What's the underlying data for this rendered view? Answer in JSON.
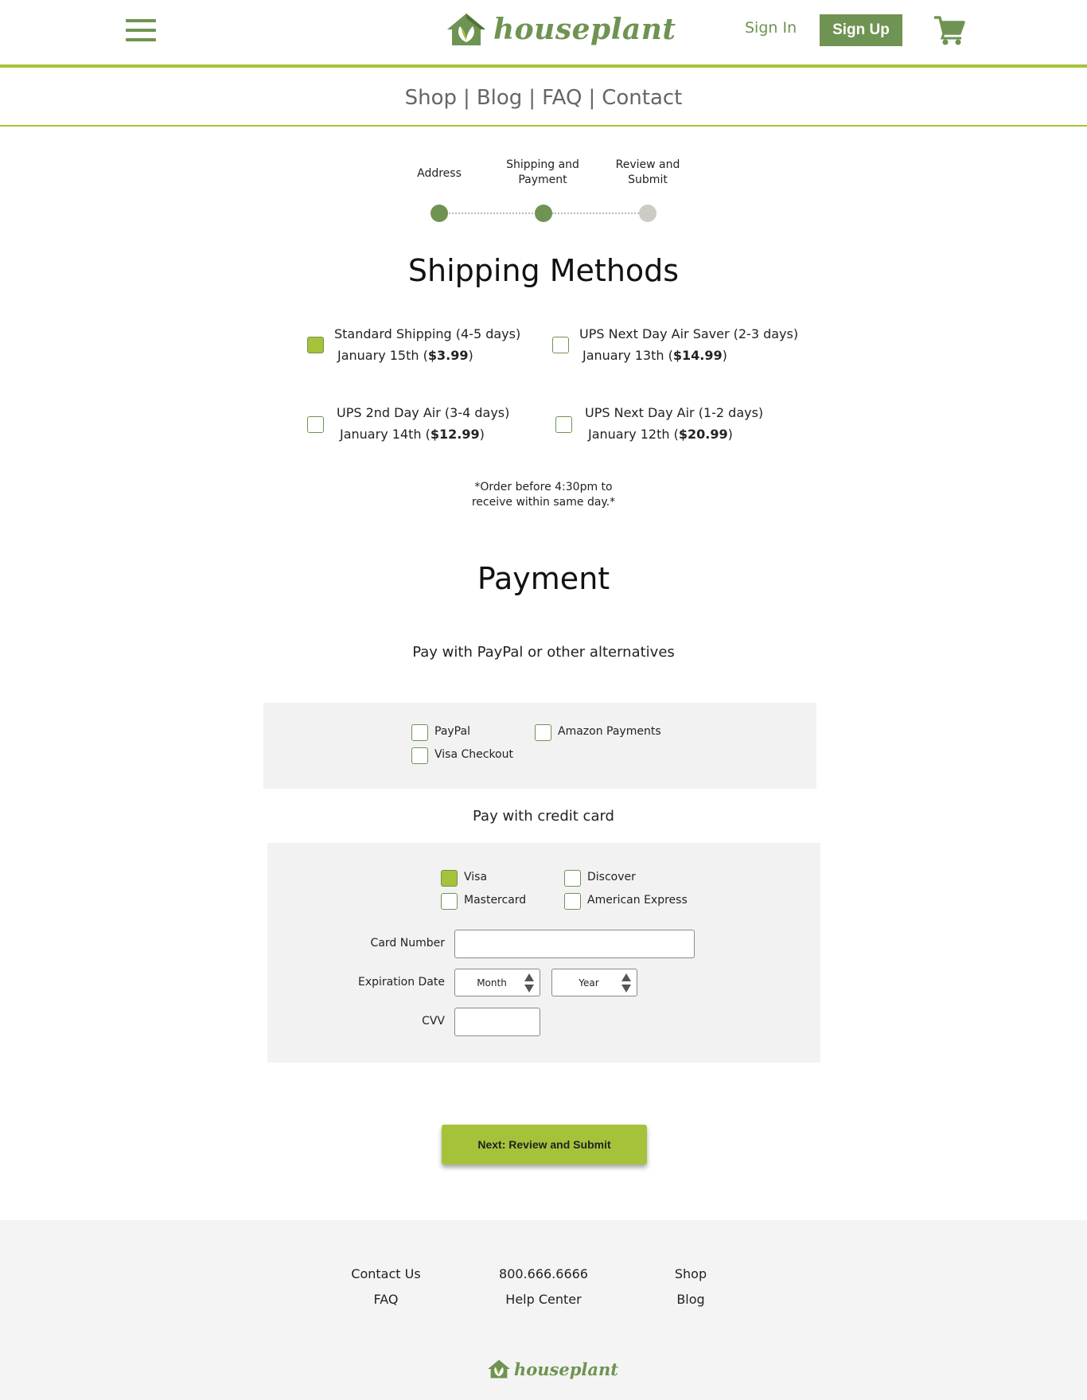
{
  "header": {
    "brand": "houseplant",
    "sign_in": "Sign In",
    "sign_up": "Sign Up"
  },
  "nav": {
    "items": [
      "Shop",
      "Blog",
      "FAQ",
      "Contact"
    ],
    "separator": "|"
  },
  "steps": {
    "items": [
      {
        "line1": "Address",
        "line2": "",
        "state": "done"
      },
      {
        "line1": "Shipping and",
        "line2": "Payment",
        "state": "done"
      },
      {
        "line1": "Review and",
        "line2": "Submit",
        "state": "todo"
      }
    ]
  },
  "shipping": {
    "title": "Shipping Methods",
    "options": [
      {
        "name": "Standard Shipping (4-5 days)",
        "date": "January 15th (",
        "price": "$3.99",
        "close": ")",
        "checked": true
      },
      {
        "name": "UPS Next Day Air Saver (2-3 days)",
        "date": "January 13th (",
        "price": "$14.99",
        "close": ")",
        "checked": false
      },
      {
        "name": "UPS 2nd Day Air (3-4 days)",
        "date": "January 14th (",
        "price": "$12.99",
        "close": ")",
        "checked": false
      },
      {
        "name": "UPS Next Day Air (1-2 days)",
        "date": "January 12th (",
        "price": "$20.99",
        "close": ")",
        "checked": false
      }
    ],
    "note_line1": "*Order before 4:30pm to",
    "note_line2": "receive within same day.*"
  },
  "payment": {
    "title": "Payment",
    "alt_title": "Pay with PayPal or other alternatives",
    "alt_options": [
      {
        "label": "PayPal",
        "checked": false
      },
      {
        "label": "Amazon Payments",
        "checked": false
      },
      {
        "label": "Visa Checkout",
        "checked": false
      }
    ],
    "card_title": "Pay with credit card",
    "card_types": [
      {
        "label": "Visa",
        "checked": true
      },
      {
        "label": "Discover",
        "checked": false
      },
      {
        "label": "Mastercard",
        "checked": false
      },
      {
        "label": "American Express",
        "checked": false
      }
    ],
    "card_number_label": "Card Number",
    "card_number_value": "",
    "expiration_label": "Expiration Date",
    "month_value": "Month",
    "year_value": "Year",
    "cvv_label": "CVV",
    "cvv_value": ""
  },
  "next_button": "Next: Review and Submit",
  "footer": {
    "col1": [
      "Contact Us",
      "FAQ"
    ],
    "col2": [
      "800.666.6666",
      "Help Center"
    ],
    "col3": [
      "Shop",
      "Blog"
    ],
    "brand": "houseplant"
  },
  "colors": {
    "brand_green": "#6f9352",
    "accent_lime": "#a6c23a",
    "panel_gray": "#f2f2f2",
    "inactive_step": "#ccccc4"
  }
}
